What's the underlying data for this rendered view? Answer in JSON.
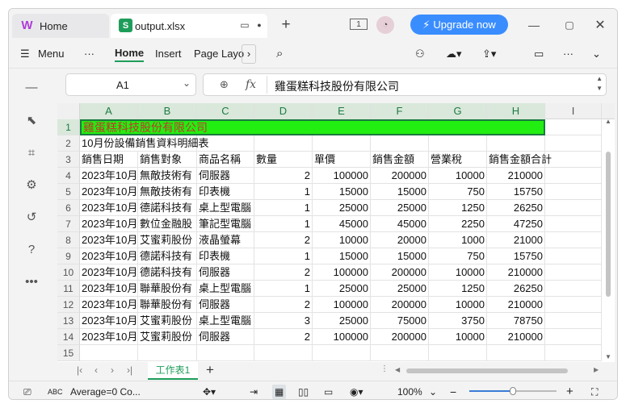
{
  "tabs": {
    "home_label": "Home",
    "file_label": "output.xlsx",
    "file_icon_letter": "S"
  },
  "titlebar": {
    "upgrade_label": "Upgrade now",
    "page_count": "1"
  },
  "ribbon": {
    "menu_label": "Menu",
    "more_label": "···",
    "home_label": "Home",
    "insert_label": "Insert",
    "pagelayout_label": "Page Layo"
  },
  "formula_bar": {
    "cell_ref": "A1",
    "fx_label": "fx",
    "content": "雞蛋糕科技股份有限公司"
  },
  "columns": [
    "A",
    "B",
    "C",
    "D",
    "E",
    "F",
    "G",
    "H",
    "I"
  ],
  "rows": [
    {
      "n": "1",
      "cells": [
        "雞蛋糕科技股份有限公司",
        "",
        "",
        "",
        "",
        "",
        "",
        ""
      ]
    },
    {
      "n": "2",
      "cells": [
        "10月份設備銷售資料明細表",
        "",
        "",
        "",
        "",
        "",
        "",
        ""
      ]
    },
    {
      "n": "3",
      "cells": [
        "銷售日期",
        "銷售對象",
        "商品名稱",
        "數量",
        "單價",
        "銷售金額",
        "營業稅",
        "銷售金額合計"
      ]
    },
    {
      "n": "4",
      "cells": [
        "2023年10月",
        "無敵技術有",
        "伺服器",
        "2",
        "100000",
        "200000",
        "10000",
        "210000"
      ]
    },
    {
      "n": "5",
      "cells": [
        "2023年10月",
        "無敵技術有",
        "印表機",
        "1",
        "15000",
        "15000",
        "750",
        "15750"
      ]
    },
    {
      "n": "6",
      "cells": [
        "2023年10月",
        "德諾科技有",
        "桌上型電腦",
        "1",
        "25000",
        "25000",
        "1250",
        "26250"
      ]
    },
    {
      "n": "7",
      "cells": [
        "2023年10月",
        "數位金融股",
        "筆記型電腦",
        "1",
        "45000",
        "45000",
        "2250",
        "47250"
      ]
    },
    {
      "n": "8",
      "cells": [
        "2023年10月",
        "艾蜜莉股份",
        "液晶螢幕",
        "2",
        "10000",
        "20000",
        "1000",
        "21000"
      ]
    },
    {
      "n": "9",
      "cells": [
        "2023年10月",
        "德諾科技有",
        "印表機",
        "1",
        "15000",
        "15000",
        "750",
        "15750"
      ]
    },
    {
      "n": "10",
      "cells": [
        "2023年10月",
        "德諾科技有",
        "伺服器",
        "2",
        "100000",
        "200000",
        "10000",
        "210000"
      ]
    },
    {
      "n": "11",
      "cells": [
        "2023年10月",
        "聯華股份有",
        "桌上型電腦",
        "1",
        "25000",
        "25000",
        "1250",
        "26250"
      ]
    },
    {
      "n": "12",
      "cells": [
        "2023年10月",
        "聯華股份有",
        "伺服器",
        "2",
        "100000",
        "200000",
        "10000",
        "210000"
      ]
    },
    {
      "n": "13",
      "cells": [
        "2023年10月",
        "艾蜜莉股份",
        "桌上型電腦",
        "3",
        "25000",
        "75000",
        "3750",
        "78750"
      ]
    },
    {
      "n": "14",
      "cells": [
        "2023年10月",
        "艾蜜莉股份",
        "伺服器",
        "2",
        "100000",
        "200000",
        "10000",
        "210000"
      ]
    },
    {
      "n": "15",
      "cells": [
        "",
        "",
        "",
        "",
        "",
        "",
        "",
        ""
      ]
    }
  ],
  "sheet_tab": "工作表1",
  "status": {
    "summary": "Average=0  Co...",
    "zoom": "100%"
  },
  "colors": {
    "accent": "#1e9d5a",
    "highlight_fill": "#22ee11",
    "highlight_text": "#c0392b",
    "upgrade": "#3a8dff"
  }
}
